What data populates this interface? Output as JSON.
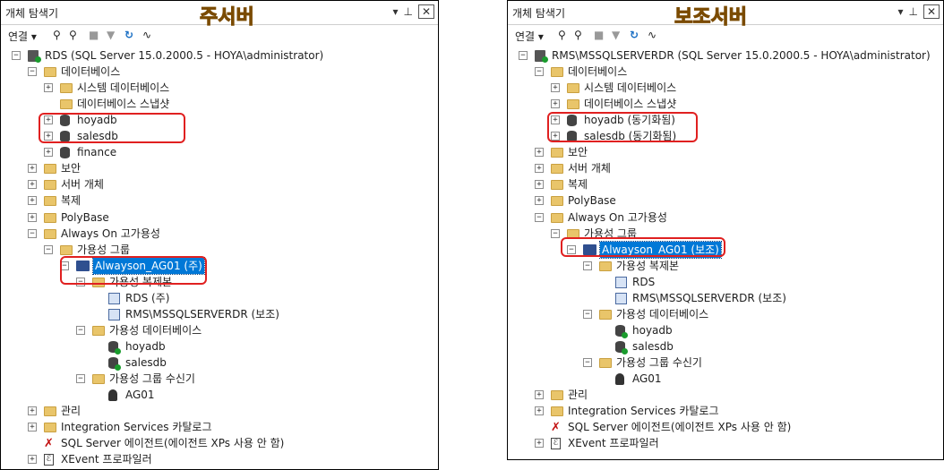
{
  "left": {
    "title": "개체 탐색기",
    "server_label": "주서버",
    "connect_label": "연결",
    "tree": [
      {
        "d": 0,
        "e": "-",
        "i": "server",
        "t": "RDS (SQL Server 15.0.2000.5 - HOYA\\administrator)"
      },
      {
        "d": 1,
        "e": "-",
        "i": "folder",
        "t": "데이터베이스"
      },
      {
        "d": 2,
        "e": "+",
        "i": "folder",
        "t": "시스템 데이터베이스"
      },
      {
        "d": 2,
        "e": "",
        "i": "folder",
        "t": "데이터베이스 스냅샷"
      },
      {
        "d": 2,
        "e": "+",
        "i": "db",
        "t": "hoyadb"
      },
      {
        "d": 2,
        "e": "+",
        "i": "db",
        "t": "salesdb"
      },
      {
        "d": 2,
        "e": "+",
        "i": "db",
        "t": "finance"
      },
      {
        "d": 1,
        "e": "+",
        "i": "folder",
        "t": "보안"
      },
      {
        "d": 1,
        "e": "+",
        "i": "folder",
        "t": "서버 개체"
      },
      {
        "d": 1,
        "e": "+",
        "i": "folder",
        "t": "복제"
      },
      {
        "d": 1,
        "e": "+",
        "i": "folder",
        "t": "PolyBase"
      },
      {
        "d": 1,
        "e": "-",
        "i": "folder",
        "t": "Always On 고가용성"
      },
      {
        "d": 2,
        "e": "-",
        "i": "folder",
        "t": "가용성 그룹"
      },
      {
        "d": 3,
        "e": "-",
        "i": "ag",
        "t": "Alwayson_AG01 (주)",
        "sel": true
      },
      {
        "d": 4,
        "e": "-",
        "i": "folder",
        "t": "가용성 복제본"
      },
      {
        "d": 5,
        "e": "",
        "i": "replica",
        "t": "RDS (주)"
      },
      {
        "d": 5,
        "e": "",
        "i": "replica",
        "t": "RMS\\MSSQLSERVERDR (보조)"
      },
      {
        "d": 4,
        "e": "-",
        "i": "folder",
        "t": "가용성 데이터베이스"
      },
      {
        "d": 5,
        "e": "",
        "i": "db-ok",
        "t": "hoyadb"
      },
      {
        "d": 5,
        "e": "",
        "i": "db-ok",
        "t": "salesdb"
      },
      {
        "d": 4,
        "e": "-",
        "i": "folder",
        "t": "가용성 그룹 수신기"
      },
      {
        "d": 5,
        "e": "",
        "i": "listener",
        "t": "AG01"
      },
      {
        "d": 1,
        "e": "+",
        "i": "folder",
        "t": "관리"
      },
      {
        "d": 1,
        "e": "+",
        "i": "folder",
        "t": "Integration Services 카탈로그"
      },
      {
        "d": 1,
        "e": "",
        "i": "agent",
        "t": "SQL Server 에이전트(에이전트 XPs 사용 안 함)"
      },
      {
        "d": 1,
        "e": "+",
        "i": "xev",
        "t": "XEvent 프로파일러"
      }
    ]
  },
  "right": {
    "title": "개체 탐색기",
    "server_label": "보조서버",
    "connect_label": "연결",
    "tree": [
      {
        "d": 0,
        "e": "-",
        "i": "server",
        "t": "RMS\\MSSQLSERVERDR (SQL Server 15.0.2000.5 - HOYA\\administrator)"
      },
      {
        "d": 1,
        "e": "-",
        "i": "folder",
        "t": "데이터베이스"
      },
      {
        "d": 2,
        "e": "+",
        "i": "folder",
        "t": "시스템 데이터베이스"
      },
      {
        "d": 2,
        "e": "+",
        "i": "folder",
        "t": "데이터베이스 스냅샷"
      },
      {
        "d": 2,
        "e": "+",
        "i": "db",
        "t": "hoyadb (동기화됨)"
      },
      {
        "d": 2,
        "e": "+",
        "i": "db",
        "t": "salesdb (동기화됨)"
      },
      {
        "d": 1,
        "e": "+",
        "i": "folder",
        "t": "보안"
      },
      {
        "d": 1,
        "e": "+",
        "i": "folder",
        "t": "서버 개체"
      },
      {
        "d": 1,
        "e": "+",
        "i": "folder",
        "t": "복제"
      },
      {
        "d": 1,
        "e": "+",
        "i": "folder",
        "t": "PolyBase"
      },
      {
        "d": 1,
        "e": "-",
        "i": "folder",
        "t": "Always On 고가용성"
      },
      {
        "d": 2,
        "e": "-",
        "i": "folder",
        "t": "가용성 그룹"
      },
      {
        "d": 3,
        "e": "-",
        "i": "ag",
        "t": "Alwayson_AG01 (보조)",
        "sel": true
      },
      {
        "d": 4,
        "e": "-",
        "i": "folder",
        "t": "가용성 복제본"
      },
      {
        "d": 5,
        "e": "",
        "i": "replica",
        "t": "RDS"
      },
      {
        "d": 5,
        "e": "",
        "i": "replica",
        "t": "RMS\\MSSQLSERVERDR (보조)"
      },
      {
        "d": 4,
        "e": "-",
        "i": "folder",
        "t": "가용성 데이터베이스"
      },
      {
        "d": 5,
        "e": "",
        "i": "db-ok",
        "t": "hoyadb"
      },
      {
        "d": 5,
        "e": "",
        "i": "db-ok",
        "t": "salesdb"
      },
      {
        "d": 4,
        "e": "-",
        "i": "folder",
        "t": "가용성 그룹 수신기"
      },
      {
        "d": 5,
        "e": "",
        "i": "listener",
        "t": "AG01"
      },
      {
        "d": 1,
        "e": "+",
        "i": "folder",
        "t": "관리"
      },
      {
        "d": 1,
        "e": "+",
        "i": "folder",
        "t": "Integration Services 카탈로그"
      },
      {
        "d": 1,
        "e": "",
        "i": "agent",
        "t": "SQL Server 에이전트(에이전트 XPs 사용 안 함)"
      },
      {
        "d": 1,
        "e": "+",
        "i": "xev",
        "t": "XEvent 프로파일러"
      }
    ]
  }
}
